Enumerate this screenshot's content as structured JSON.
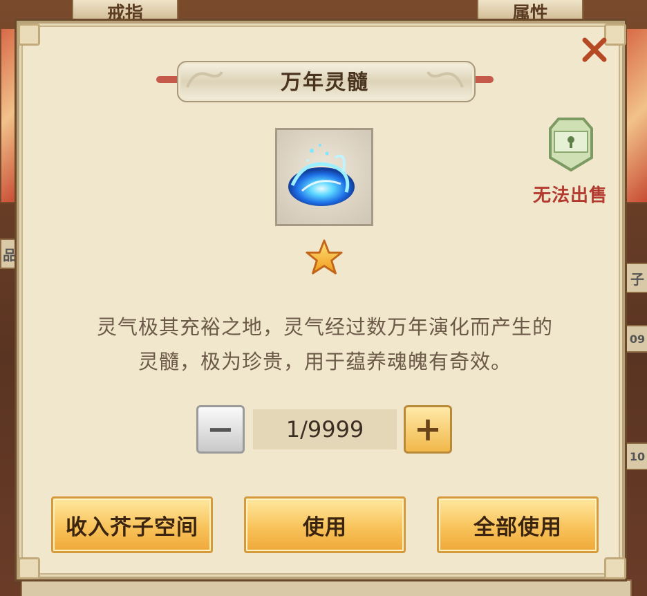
{
  "background": {
    "tab_left": "戒指",
    "tab_right": "属性",
    "side_text_left": "品",
    "side_text_right": "子",
    "side_number_right_1": "09",
    "side_number_right_2": "10"
  },
  "dialog": {
    "title": "万年灵髓",
    "close_icon": "close-icon",
    "item_icon": "blue-spirit-swirl-icon",
    "rarity_stars": 1,
    "lock_badge_icon": "lock-icon",
    "no_sell_label": "无法出售",
    "description_lines": [
      "灵气极其充裕之地，灵气经过数万年演化而产生的",
      "灵髓，极为珍贵，用于蕴养魂魄有奇效。"
    ],
    "quantity": {
      "minus_symbol": "−",
      "plus_symbol": "+",
      "display": "1/9999"
    },
    "buttons": {
      "store": "收入芥子空间",
      "use": "使用",
      "use_all": "全部使用"
    }
  },
  "colors": {
    "accent_gold": "#f8c35a",
    "close_red": "#b64a24",
    "warning_red": "#b23a2e",
    "parchment": "#f1e7cc"
  }
}
